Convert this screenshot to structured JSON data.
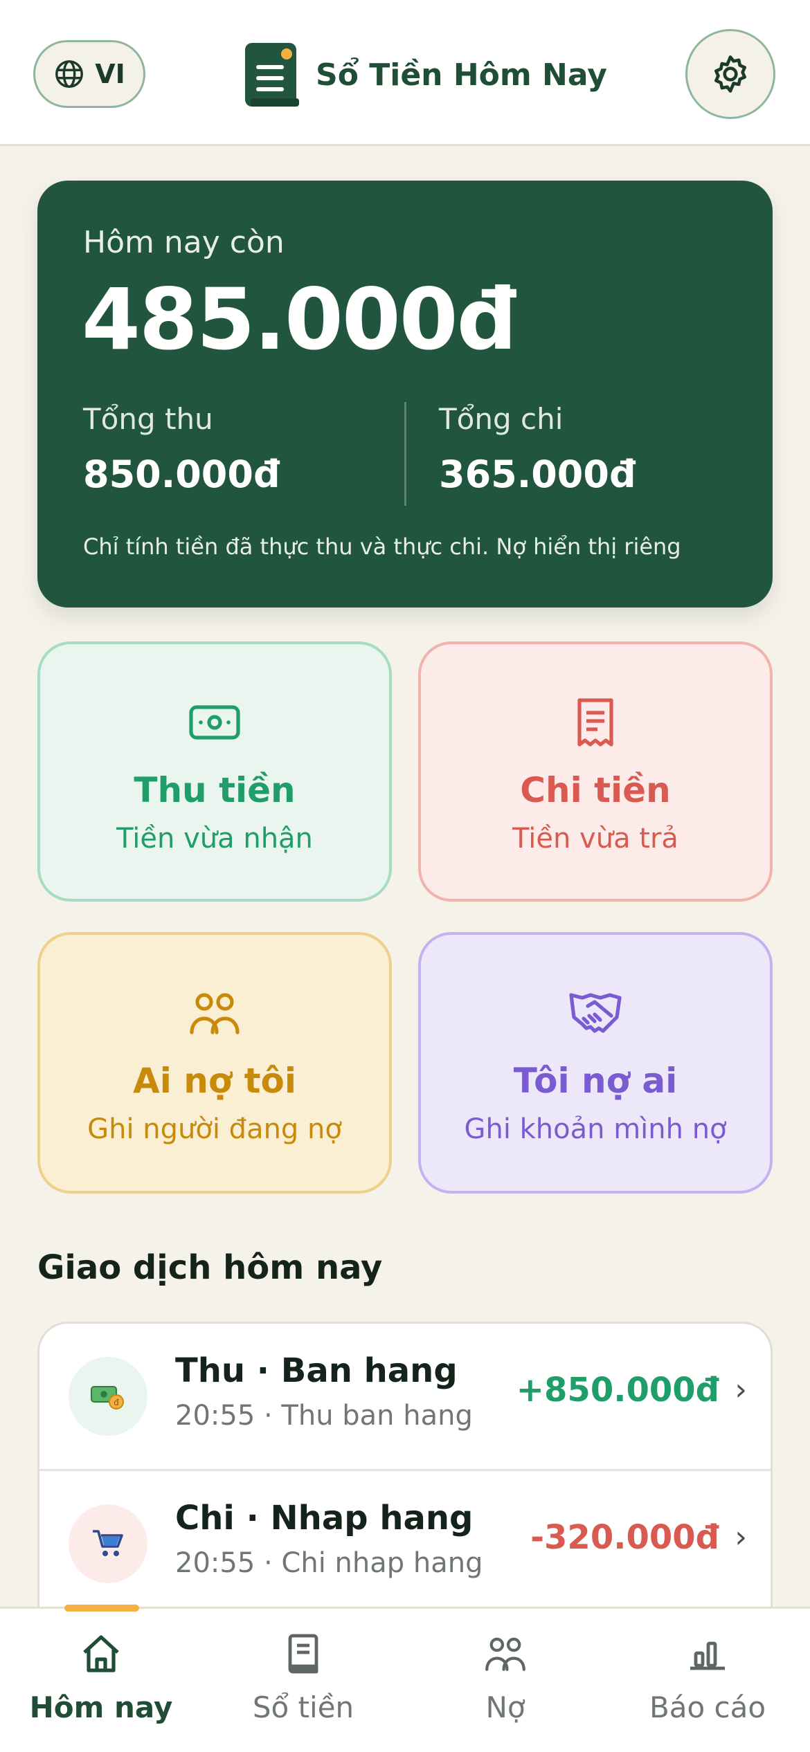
{
  "header": {
    "language": "VI",
    "app_title": "Sổ Tiền Hôm Nay"
  },
  "balance": {
    "label": "Hôm nay còn",
    "amount": "485.000đ",
    "income_label": "Tổng thu",
    "income_value": "850.000đ",
    "expense_label": "Tổng chi",
    "expense_value": "365.000đ",
    "note": "Chỉ tính tiền đã thực thu và thực chi. Nợ hiển thị riêng"
  },
  "actions": {
    "income": {
      "title": "Thu tiền",
      "subtitle": "Tiền vừa nhận",
      "icon": "cash-icon"
    },
    "expense": {
      "title": "Chi tiền",
      "subtitle": "Tiền vừa trả",
      "icon": "receipt-icon"
    },
    "owed": {
      "title": "Ai nợ tôi",
      "subtitle": "Ghi người đang nợ",
      "icon": "people-icon"
    },
    "owe": {
      "title": "Tôi nợ ai",
      "subtitle": "Ghi khoản mình nợ",
      "icon": "handshake-icon"
    }
  },
  "transactions": {
    "section_title": "Giao dịch hôm nay",
    "items": [
      {
        "title": "Thu · Ban hang",
        "subtitle": "20:55 · Thu ban hang",
        "amount": "+850.000đ",
        "icon": "money-icon"
      },
      {
        "title": "Chi · Nhap hang",
        "subtitle": "20:55 · Chi nhap hang",
        "amount": "-320.000đ",
        "icon": "cart-icon"
      }
    ]
  },
  "nav": {
    "items": [
      {
        "label": "Hôm nay",
        "icon": "home-icon"
      },
      {
        "label": "Sổ tiền",
        "icon": "book-icon"
      },
      {
        "label": "Nợ",
        "icon": "people-icon"
      },
      {
        "label": "Báo cáo",
        "icon": "chart-icon"
      }
    ]
  },
  "colors": {
    "primary": "#22553d",
    "income": "#1f9e69",
    "expense": "#d95a50",
    "owed": "#c78a0a",
    "owe": "#7a5bd0",
    "accent": "#f5b041"
  }
}
